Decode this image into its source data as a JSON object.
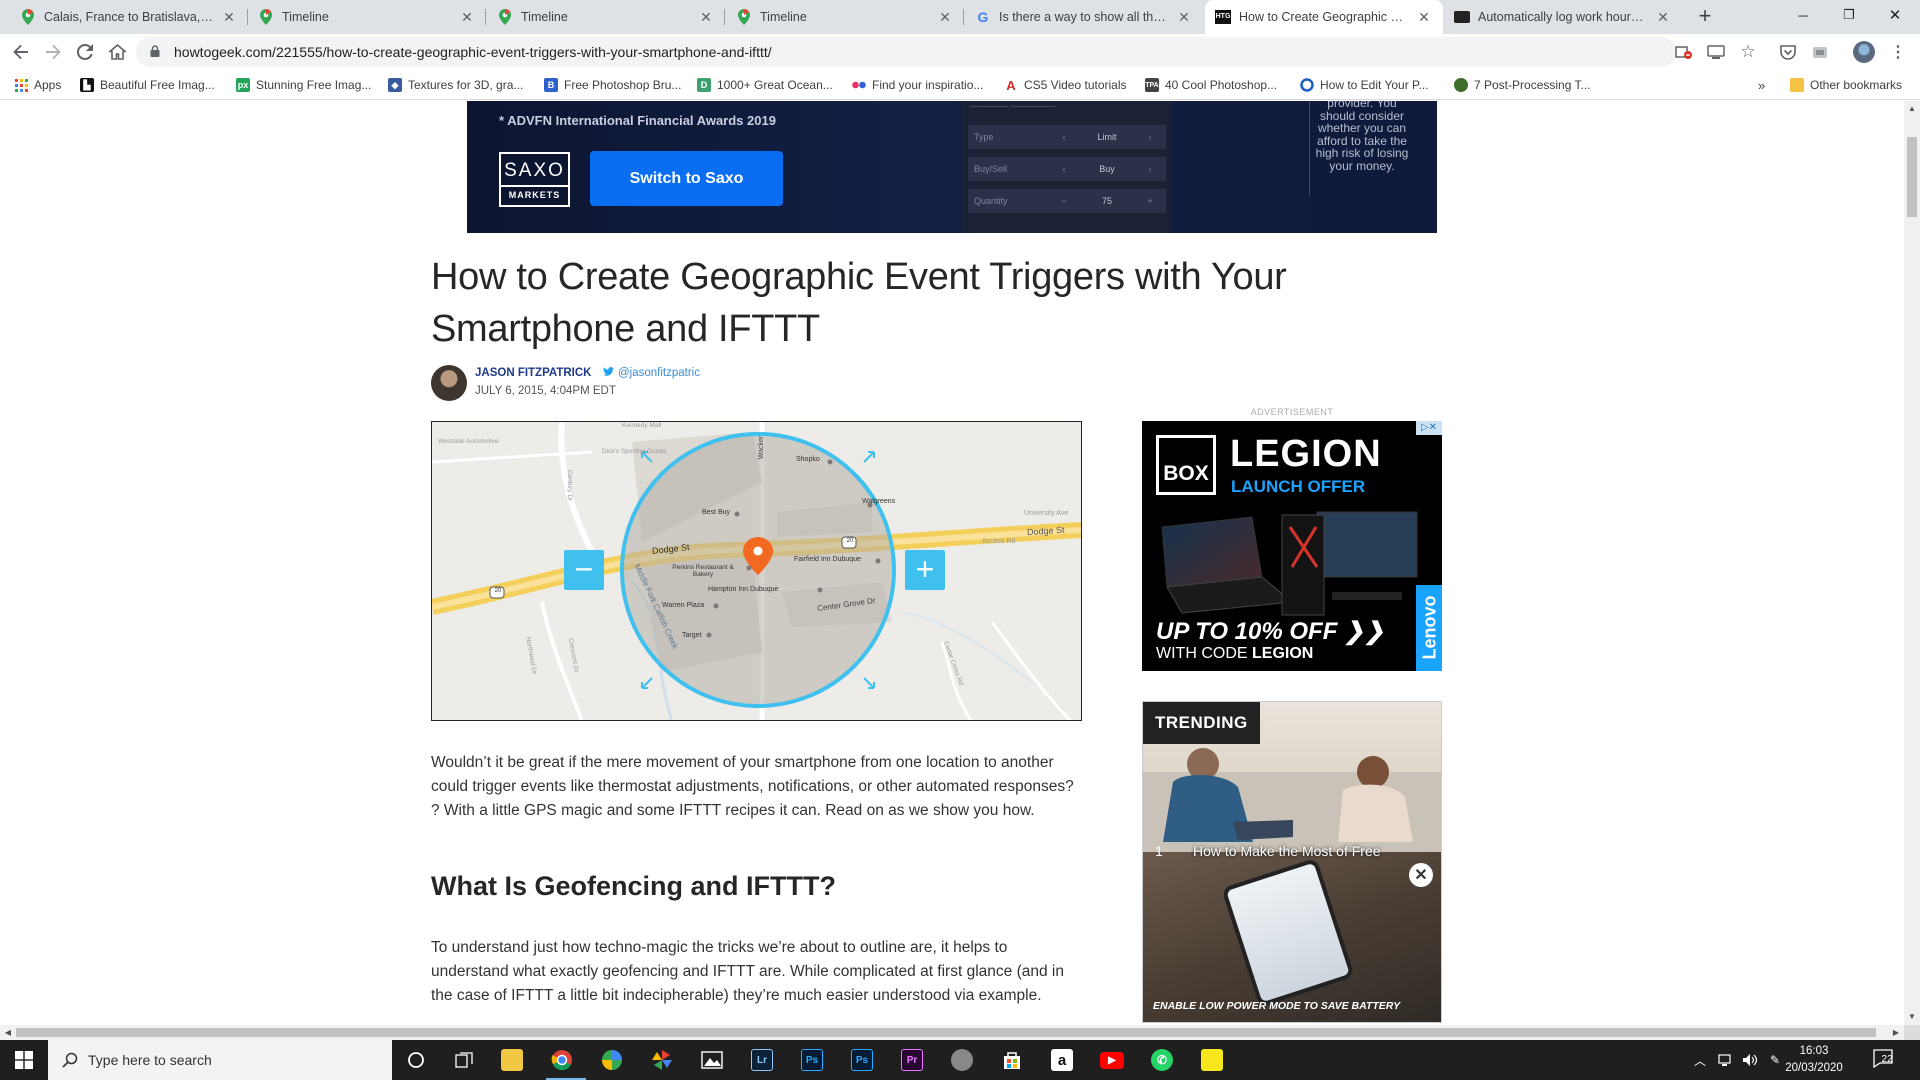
{
  "tabs": [
    {
      "title": "Calais, France to Bratislava, Slovakia",
      "icon": "maps-pin-icon"
    },
    {
      "title": "Timeline",
      "icon": "maps-pin-icon"
    },
    {
      "title": "Timeline",
      "icon": "maps-pin-icon"
    },
    {
      "title": "Timeline",
      "icon": "maps-pin-icon"
    },
    {
      "title": "Is there a way to show all the data",
      "icon": "google-g-icon"
    },
    {
      "title": "How to Create Geographic Event",
      "icon": "htg-icon"
    },
    {
      "title": "Automatically log work hours in a",
      "icon": "site-icon"
    }
  ],
  "address": {
    "url": "howtogeek.com/221555/how-to-create-geographic-event-triggers-with-your-smartphone-and-ifttt/"
  },
  "bookmarks": [
    {
      "label": "Apps",
      "color": "#e8453c"
    },
    {
      "label": "Beautiful Free Imag...",
      "color": "#111111"
    },
    {
      "label": "Stunning Free Imag...",
      "color": "#22a55a"
    },
    {
      "label": "Textures for 3D, gra...",
      "color": "#3a5ba0"
    },
    {
      "label": "Free Photoshop Bru...",
      "color": "#2d63c8"
    },
    {
      "label": "1000+ Great Ocean...",
      "color": "#3da06e"
    },
    {
      "label": "Find your inspiratio...",
      "color": "#e8336b"
    },
    {
      "label": "CS5 Video tutorials",
      "color": "#d62b2b"
    },
    {
      "label": "40 Cool Photoshop...",
      "color": "#444444"
    },
    {
      "label": "How to Edit Your P...",
      "color": "#1f5fbf"
    },
    {
      "label": "7 Post-Processing T...",
      "color": "#3c6e2a"
    }
  ],
  "other_bookmarks": "Other bookmarks",
  "more_bookmarks": "»",
  "top_ad": {
    "award": "* ADVFN International Financial Awards 2019",
    "logo_top": "SAXO",
    "logo_bottom": "MARKETS",
    "cta": "Switch to Saxo",
    "trade_rows": [
      {
        "label": "Type",
        "value": "Limit"
      },
      {
        "label": "Buy/Sell",
        "value": "Buy"
      },
      {
        "label": "Quantity",
        "value": "75"
      }
    ],
    "risk_text": "provider. You should consider whether you can afford to take the high risk of losing your money."
  },
  "article": {
    "title": "How to Create Geographic Event Triggers with Your Smartphone and IFTTT",
    "author": "JASON FITZPATRICK",
    "twitter": "@jasonfitzpatric",
    "date": "JULY 6, 2015, 4:04PM EDT",
    "intro": "Wouldn’t it be great if the mere movement of your smartphone from one location to another could trigger events like thermostat adjustments, notifications, or other automated responses? ? With a little GPS magic and some IFTTT recipes it can. Read on as we show you how.",
    "h2": "What Is Geofencing and IFTTT?",
    "para2": "To understand just how techno-magic the tricks we’re about to outline are, it helps to understand what exactly geofencing and IFTTT are. While complicated at first glance (and in the case of IFTTT a little bit indecipherable) they’re much easier understood via example."
  },
  "map": {
    "labels": [
      "Dodge St",
      "Dodge St",
      "Best Buy",
      "Shopko",
      "Walgreens",
      "Perkins Restaurant & Bakery",
      "Fairfield Inn Dubuque",
      "Hampton Inn Dubuque",
      "Warren Plaza",
      "Target",
      "Center Grove Dr",
      "Middle Fork Catfish Creek",
      "Wacker",
      "Kennedy Mall",
      "Westside Automotive",
      "Dick's Sporting Goods",
      "Access Rd",
      "University Ave",
      "Century Dr",
      "Northwest Dr",
      "Crescent Dr",
      "Cedar Cross Rd"
    ],
    "shields": [
      "20",
      "20"
    ],
    "zoom_out": "−",
    "zoom_in": "+"
  },
  "sidebar": {
    "ad_label": "ADVERTISEMENT",
    "lenovo": {
      "box": "BOX",
      "legion": "LEGION",
      "launch": "LAUNCH OFFER",
      "offer": "UP TO 10% OFF ❯❯",
      "code_prefix": "WITH CODE",
      "code": "LEGION",
      "brand": "Lenovo"
    },
    "trending": {
      "badge": "TRENDING",
      "num": "1",
      "article": "How to Make the Most of Free",
      "caption": "ENABLE LOW POWER MODE TO SAVE BATTERY"
    }
  },
  "taskbar": {
    "search_placeholder": "Type here to search",
    "time": "16:03",
    "date": "20/03/2020",
    "notifications": "22",
    "apps": [
      {
        "name": "cortana",
        "label": "○",
        "color": "#1f1f1f"
      },
      {
        "name": "task-view",
        "label": "⧉",
        "color": "#1f1f1f"
      },
      {
        "name": "file-explorer",
        "label": "",
        "color": "#f2c744"
      },
      {
        "name": "chrome",
        "label": "",
        "color": "#db4437"
      },
      {
        "name": "maps",
        "label": "",
        "color": "#34a853"
      },
      {
        "name": "pinwheel",
        "label": "",
        "color": "#f4b400"
      },
      {
        "name": "photos",
        "label": "",
        "color": "#555555"
      },
      {
        "name": "lightroom",
        "label": "Lr",
        "color": "#0b2238"
      },
      {
        "name": "photoshop",
        "label": "Ps",
        "color": "#001d34"
      },
      {
        "name": "photoshop-2",
        "label": "Ps",
        "color": "#001d34"
      },
      {
        "name": "premiere",
        "label": "Pr",
        "color": "#2a0634"
      },
      {
        "name": "disk-app",
        "label": "",
        "color": "#777777"
      },
      {
        "name": "store",
        "label": "",
        "color": "#333333"
      },
      {
        "name": "amazon",
        "label": "a",
        "color": "#ffffff"
      },
      {
        "name": "youtube",
        "label": "▶",
        "color": "#ff0000"
      },
      {
        "name": "whatsapp",
        "label": "✆",
        "color": "#25d366"
      },
      {
        "name": "sticky-notes",
        "label": "",
        "color": "#f8e71c"
      }
    ]
  }
}
